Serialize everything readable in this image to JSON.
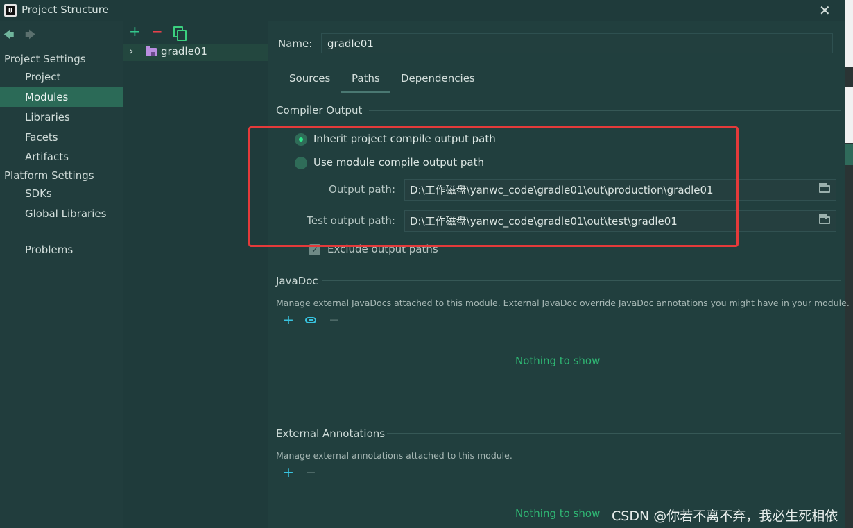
{
  "window": {
    "title": "Project Structure",
    "close_symbol": "✕"
  },
  "sidebar": {
    "back_symbol": "🡄",
    "forward_symbol": "🡆",
    "project_settings_header": "Project Settings",
    "project_settings": [
      "Project",
      "Modules",
      "Libraries",
      "Facets",
      "Artifacts"
    ],
    "platform_settings_header": "Platform Settings",
    "platform_settings": [
      "SDKs",
      "Global Libraries"
    ],
    "problems": "Problems",
    "selected": "Modules"
  },
  "module_tree": {
    "add_symbol": "+",
    "remove_symbol": "−",
    "expand_symbol": "›",
    "module_name": "gradle01"
  },
  "module": {
    "name_label": "Name:",
    "name_value": "gradle01",
    "tabs": [
      "Sources",
      "Paths",
      "Dependencies"
    ],
    "active_tab": "Paths"
  },
  "compiler_output": {
    "title": "Compiler Output",
    "option_inherit": "Inherit project compile output path",
    "option_module": "Use module compile output path",
    "selected_option": "inherit",
    "output_path_label": "Output path:",
    "output_path_value": "D:\\工作磁盘\\yanwc_code\\gradle01\\out\\production\\gradle01",
    "test_output_path_label": "Test output path:",
    "test_output_path_value": "D:\\工作磁盘\\yanwc_code\\gradle01\\out\\test\\gradle01",
    "exclude_label": "Exclude output paths",
    "exclude_checked": true
  },
  "javadoc": {
    "title": "JavaDoc",
    "description": "Manage external JavaDocs attached to this module. External JavaDoc override JavaDoc annotations you might have in your module.",
    "empty_text": "Nothing to show"
  },
  "external_annotations": {
    "title": "External Annotations",
    "description": "Manage external annotations attached to this module.",
    "empty_text": "Nothing to show"
  },
  "watermark": "CSDN @你若不离不弃，我必生死相依",
  "colors": {
    "background": "#213d3d",
    "selection": "#2b6a57",
    "accent_green": "#2fb874",
    "highlight_box": "#e43a3a"
  }
}
